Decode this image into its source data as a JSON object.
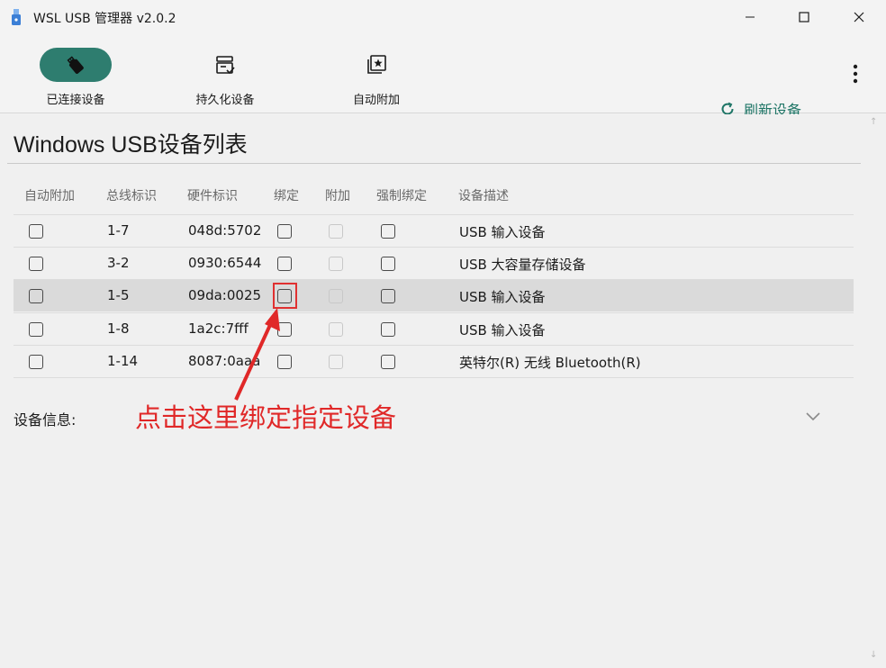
{
  "window": {
    "title": "WSL USB 管理器 v2.0.2"
  },
  "toolbar": {
    "tabs": [
      {
        "label": "已连接设备",
        "icon": "usb-stick-icon",
        "active": true
      },
      {
        "label": "持久化设备",
        "icon": "persist-icon",
        "active": false
      },
      {
        "label": "自动附加",
        "icon": "auto-attach-icon",
        "active": false
      }
    ],
    "refresh_label": "刷新设备",
    "accent": "#2e7d6f"
  },
  "main": {
    "title": "Windows USB设备列表",
    "columns": [
      "自动附加",
      "总线标识",
      "硬件标识",
      "绑定",
      "附加",
      "强制绑定",
      "设备描述"
    ],
    "rows": [
      {
        "bus": "1-7",
        "hw": "048d:5702",
        "desc": "USB 输入设备",
        "selected": false
      },
      {
        "bus": "3-2",
        "hw": "0930:6544",
        "desc": "USB 大容量存储设备",
        "selected": false
      },
      {
        "bus": "1-5",
        "hw": "09da:0025",
        "desc": "USB 输入设备",
        "selected": true
      },
      {
        "bus": "1-8",
        "hw": "1a2c:7fff",
        "desc": "USB 输入设备",
        "selected": false
      },
      {
        "bus": "1-14",
        "hw": "8087:0aaa",
        "desc": "英特尔(R) 无线 Bluetooth(R)",
        "selected": false
      }
    ],
    "device_info_label": "设备信息:"
  },
  "annotation": {
    "text": "点击这里绑定指定设备",
    "color": "#e02828"
  }
}
